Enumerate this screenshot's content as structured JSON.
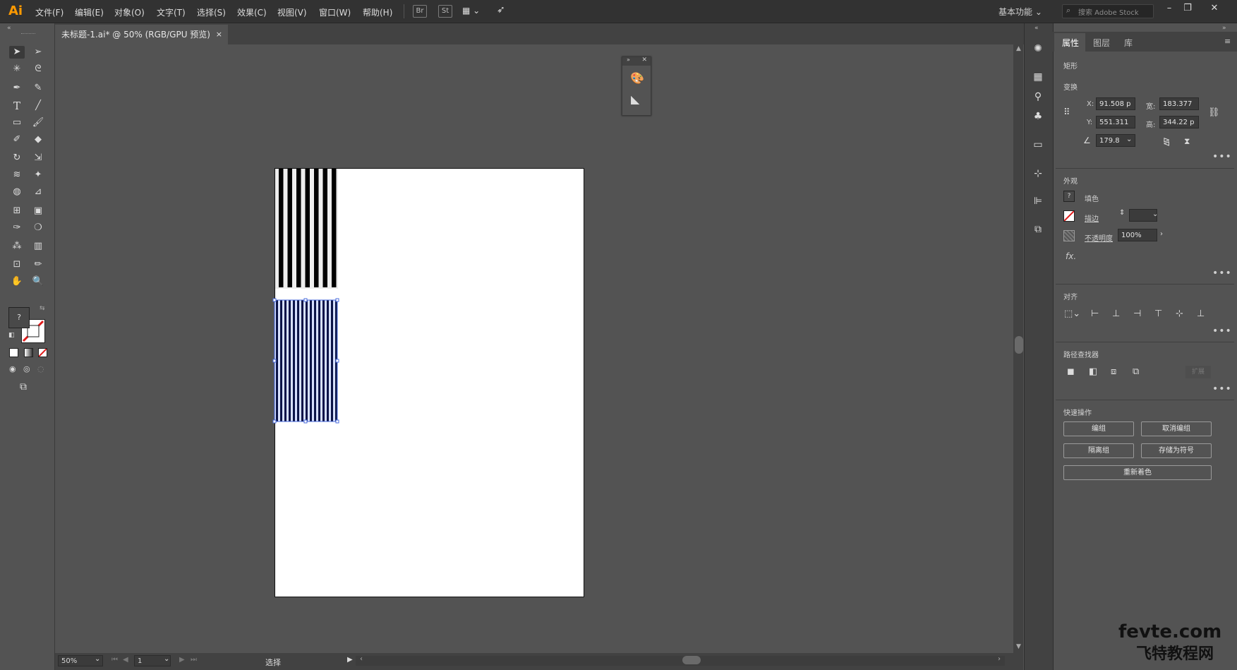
{
  "app": {
    "logo": "Ai"
  },
  "menu": [
    "文件(F)",
    "编辑(E)",
    "对象(O)",
    "文字(T)",
    "选择(S)",
    "效果(C)",
    "视图(V)",
    "窗口(W)",
    "帮助(H)"
  ],
  "top_icons": {
    "br": "Br",
    "st": "St"
  },
  "workspace": {
    "label": "基本功能"
  },
  "search": {
    "placeholder": "搜索 Adobe Stock"
  },
  "document": {
    "tab_title": "未标题-1.ai* @ 50% (RGB/GPU 预览)",
    "close": "×"
  },
  "status": {
    "zoom": "50%",
    "page": "1",
    "tool": "选择"
  },
  "fill_indicator": "?",
  "properties": {
    "tabs": [
      "属性",
      "图层",
      "库"
    ],
    "object_type": "矩形",
    "transform": {
      "title": "变换",
      "x_label": "X:",
      "x": "91.508 p",
      "y_label": "Y:",
      "y": "551.311",
      "w_label": "宽:",
      "w": "183.377",
      "h_label": "高:",
      "h": "344.22 p",
      "angle": "179.8"
    },
    "appearance": {
      "title": "外观",
      "fill_label": "填色",
      "stroke_label": "描边",
      "opacity_label": "不透明度",
      "opacity": "100%",
      "fx": "fx."
    },
    "align": {
      "title": "对齐"
    },
    "pathfinder": {
      "title": "路径查找器",
      "expand": "扩展"
    },
    "quick_actions": {
      "title": "快速操作",
      "group": "编组",
      "ungroup": "取消编组",
      "isolate": "隔离组",
      "save_symbol": "存储为符号",
      "recolor": "重新着色"
    }
  },
  "watermark": {
    "line1": "fevte.com",
    "line2": "飞特教程网"
  },
  "colors": {
    "accent": "#ff9a00",
    "selection": "#4a6bdc",
    "panel": "#535353",
    "dark": "#323232"
  }
}
